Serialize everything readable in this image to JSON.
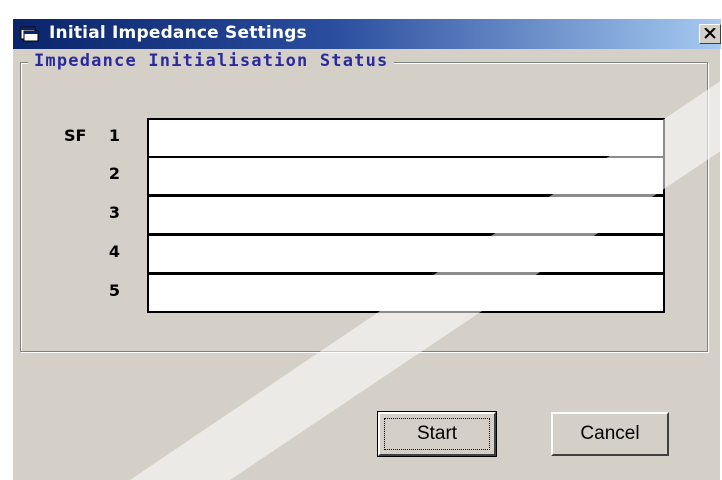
{
  "window": {
    "title": "Initial Impedance Settings",
    "title_icon": "window-app-icon",
    "close_glyph": "×"
  },
  "group": {
    "legend": "Impedance Initialisation Status",
    "sf_prefix": "SF",
    "rows": [
      {
        "number": "1",
        "status": ""
      },
      {
        "number": "2",
        "status": ""
      },
      {
        "number": "3",
        "status": ""
      },
      {
        "number": "4",
        "status": ""
      },
      {
        "number": "5",
        "status": ""
      }
    ]
  },
  "buttons": {
    "start_label": "Start",
    "cancel_label": "Cancel"
  },
  "colors": {
    "title_bar_start": "#0a246a",
    "title_bar_end": "#a6caf0",
    "legend_text": "#2a2aa0",
    "dialog_face": "#d4d0c8"
  }
}
